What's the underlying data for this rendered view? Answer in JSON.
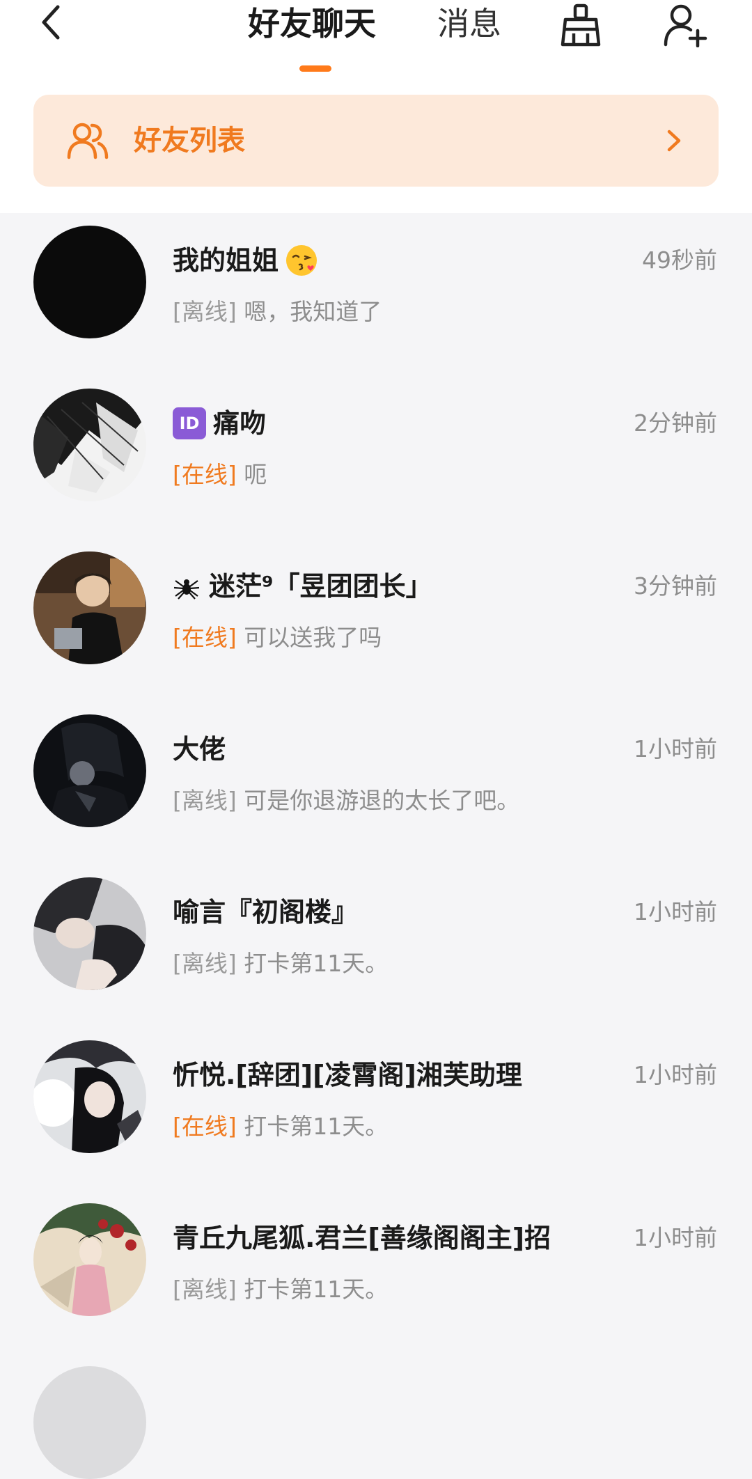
{
  "header": {
    "tab_active": "好友聊天",
    "tab_inactive": "消息",
    "accent_color": "#ff7a1a"
  },
  "friend_list_card": {
    "label": "好友列表",
    "background": "#fde9da"
  },
  "status_colors": {
    "online": "#f07a1f",
    "offline": "#9a9a9a"
  },
  "chats": [
    {
      "name": "我的姐姐",
      "badge": "kiss-emoji",
      "time": "49秒前",
      "status": "[离线]",
      "status_type": "offline",
      "message": "嗯，我知道了"
    },
    {
      "name": "痛吻",
      "badge_text": "ID",
      "time": "2分钟前",
      "status": "[在线]",
      "status_type": "online",
      "message": "呃"
    },
    {
      "name": "迷茫⁹「昱团团长」",
      "badge": "spider-emoji",
      "time": "3分钟前",
      "status": "[在线]",
      "status_type": "online",
      "message": "可以送我了吗"
    },
    {
      "name": "大佬",
      "time": "1小时前",
      "status": "[离线]",
      "status_type": "offline",
      "message": "可是你退游退的太长了吧。"
    },
    {
      "name": "喻言『初阁楼』",
      "time": "1小时前",
      "status": "[离线]",
      "status_type": "offline",
      "message": "打卡第11天。"
    },
    {
      "name": "忻悦.[辞团][凌霄阁]湘芙助理",
      "time": "1小时前",
      "status": "[在线]",
      "status_type": "online",
      "message": "打卡第11天。"
    },
    {
      "name": "青丘九尾狐.君兰[善缘阁阁主]招",
      "time": "1小时前",
      "status": "[离线]",
      "status_type": "offline",
      "message": "打卡第11天。"
    }
  ]
}
